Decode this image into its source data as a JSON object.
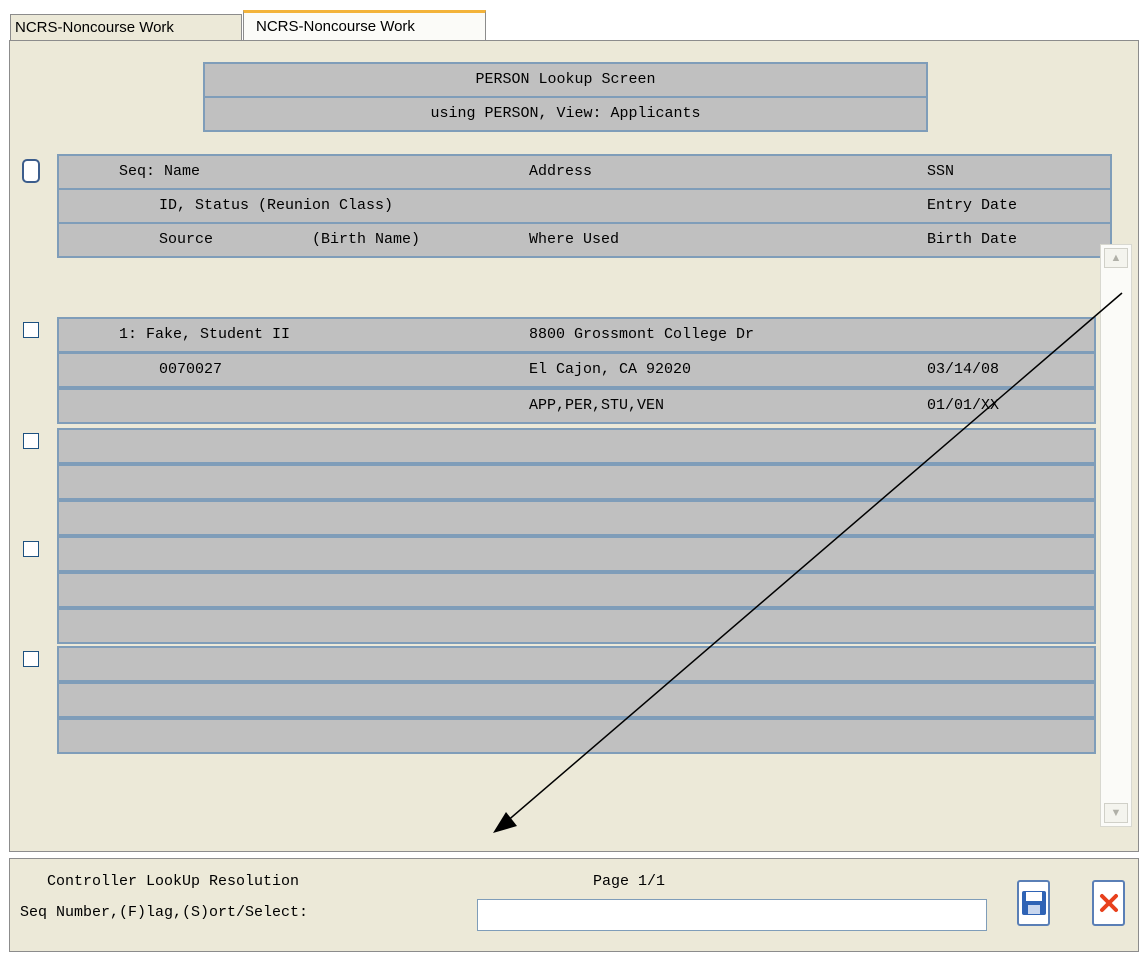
{
  "tabs": [
    "NCRS-Noncourse Work",
    "NCRS-Noncourse Work"
  ],
  "header": {
    "title": "PERSON Lookup Screen",
    "subtitle": "using PERSON, View: Applicants"
  },
  "columns": {
    "row1": {
      "seq_name": "Seq: Name",
      "address": "Address",
      "ssn": "SSN"
    },
    "row2": {
      "id_status": "ID, Status (Reunion Class)",
      "entry_date": "Entry Date"
    },
    "row3": {
      "source": "Source",
      "birth_name": "(Birth Name)",
      "where_used": "Where Used",
      "birth_date": "Birth Date"
    }
  },
  "records": [
    {
      "seq_name": "1: Fake, Student II",
      "address": "8800 Grossmont College Dr",
      "ssn": "",
      "id": "0070027",
      "address2": "El Cajon, CA 92020",
      "entry_date": "03/14/08",
      "source": "",
      "where_used": "APP,PER,STU,VEN",
      "birth_date": "01/01/XX"
    }
  ],
  "footer": {
    "title": "Controller LookUp Resolution",
    "page": "Page 1/1",
    "prompt": "Seq Number,(F)lag,(S)ort/Select:",
    "input_value": ""
  },
  "icons": {
    "save": "save-icon",
    "cancel": "close-icon"
  },
  "colors": {
    "panel": "#ece9d8",
    "row": "#c0c0c0",
    "row_border": "#7f9db9",
    "tab_accent": "#f3b33a",
    "cancel_red": "#e8401c"
  }
}
